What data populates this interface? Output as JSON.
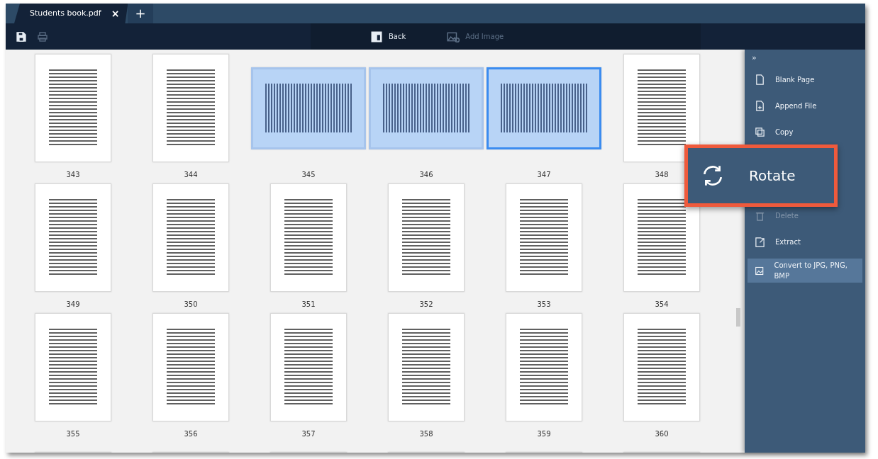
{
  "tabs": [
    {
      "label": "Students book.pdf",
      "selected": true,
      "close": "×"
    }
  ],
  "new_tab": "+",
  "toolbar": {
    "left_tools": [
      {
        "kind": "save",
        "disabled": false
      },
      {
        "kind": "print",
        "disabled": true
      }
    ],
    "center_buttons": [
      {
        "kind": "back",
        "label": "Back",
        "disabled": false
      },
      {
        "kind": "image",
        "label": "Add Image",
        "disabled": true
      }
    ]
  },
  "pages": [
    {
      "number": "343",
      "kind": "portrait",
      "selected": false,
      "focused": false
    },
    {
      "number": "344",
      "kind": "portrait",
      "selected": false,
      "focused": false
    },
    {
      "number": "345",
      "kind": "landscape",
      "selected": true,
      "focused": false
    },
    {
      "number": "346",
      "kind": "landscape",
      "selected": true,
      "focused": false
    },
    {
      "number": "347",
      "kind": "landscape",
      "selected": true,
      "focused": true
    },
    {
      "number": "348",
      "kind": "portrait",
      "selected": false,
      "focused": false
    },
    {
      "number": "349",
      "kind": "portrait",
      "selected": false,
      "focused": false
    },
    {
      "number": "350",
      "kind": "portrait",
      "selected": false,
      "focused": false
    },
    {
      "number": "351",
      "kind": "portrait",
      "selected": false,
      "focused": false
    },
    {
      "number": "352",
      "kind": "portrait",
      "selected": false,
      "focused": false
    },
    {
      "number": "353",
      "kind": "portrait",
      "selected": false,
      "focused": false
    },
    {
      "number": "354",
      "kind": "portrait",
      "selected": false,
      "focused": false
    },
    {
      "number": "355",
      "kind": "portrait",
      "selected": false,
      "focused": false
    },
    {
      "number": "356",
      "kind": "portrait",
      "selected": false,
      "focused": false
    },
    {
      "number": "357",
      "kind": "portrait",
      "selected": false,
      "focused": false
    },
    {
      "number": "358",
      "kind": "portrait",
      "selected": false,
      "focused": false
    },
    {
      "number": "359",
      "kind": "portrait",
      "selected": false,
      "focused": false
    },
    {
      "number": "360",
      "kind": "portrait",
      "selected": false,
      "focused": false
    }
  ],
  "side_panel": {
    "collapse": "»",
    "items": [
      {
        "kind": "blank",
        "label": "Blank Page",
        "disabled": false,
        "selected": false
      },
      {
        "kind": "append",
        "label": "Append File",
        "disabled": false,
        "selected": false
      },
      {
        "kind": "copy",
        "label": "Copy",
        "disabled": false,
        "selected": false
      },
      {
        "kind": "delete",
        "label": "Delete",
        "disabled": true,
        "selected": false
      },
      {
        "kind": "extract",
        "label": "Extract",
        "disabled": false,
        "selected": false
      },
      {
        "kind": "convert",
        "label": "Convert to JPG, PNG, BMP",
        "disabled": false,
        "selected": true
      }
    ]
  },
  "callout": {
    "label": "Rotate"
  }
}
